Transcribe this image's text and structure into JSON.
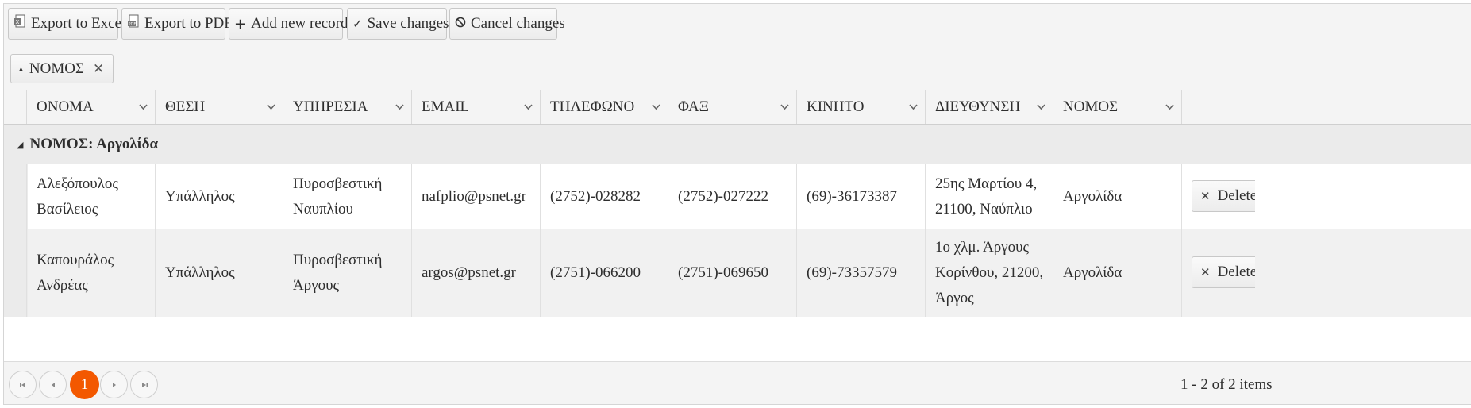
{
  "toolbar": {
    "export_excel": "Export to Excel",
    "export_pdf": "Export to PDF",
    "add_record": "Add new record",
    "save_changes": "Save changes",
    "cancel_changes": "Cancel changes"
  },
  "grouping": {
    "chip_label": "ΝΟΜΟΣ"
  },
  "columns": [
    "ΟΝΟΜΑ",
    "ΘΕΣΗ",
    "ΥΠΗΡΕΣΙΑ",
    "EMAIL",
    "ΤΗΛΕΦΩΝΟ",
    "ΦΑΞ",
    "ΚΙΝΗΤΟ",
    "ΔΙΕΥΘΥΝΣΗ",
    "ΝΟΜΟΣ"
  ],
  "group": {
    "label": "ΝΟΜΟΣ: Αργολίδα"
  },
  "rows": [
    {
      "name": "Αλεξόπουλος Βασίλειος",
      "position": "Υπάλληλος",
      "service": "Πυροσβεστική Ναυπλίου",
      "email": "nafplio@psnet.gr",
      "phone": "(2752)-028282",
      "fax": "(2752)-027222",
      "mobile": "(69)-36173387",
      "address": "25ης Μαρτίου 4, 21100, Ναύπλιο",
      "prefecture": "Αργολίδα",
      "delete_label": "Delete"
    },
    {
      "name": "Καπουράλος Ανδρέας",
      "position": "Υπάλληλος",
      "service": "Πυροσβεστική Άργους",
      "email": "argos@psnet.gr",
      "phone": "(2751)-066200",
      "fax": "(2751)-069650",
      "mobile": "(69)-73357579",
      "address": "1ο χλμ. Άργους Κορίνθου, 21200, Άργος",
      "prefecture": "Αργολίδα",
      "delete_label": "Delete"
    }
  ],
  "pager": {
    "current_page": "1",
    "info": "1 - 2 of 2 items"
  },
  "icons": {
    "excel": "excel-icon",
    "pdf": "pdf-icon",
    "add": "plus-icon",
    "save": "check-icon",
    "cancel": "cancel-icon"
  },
  "colors": {
    "accent": "#f35800"
  }
}
